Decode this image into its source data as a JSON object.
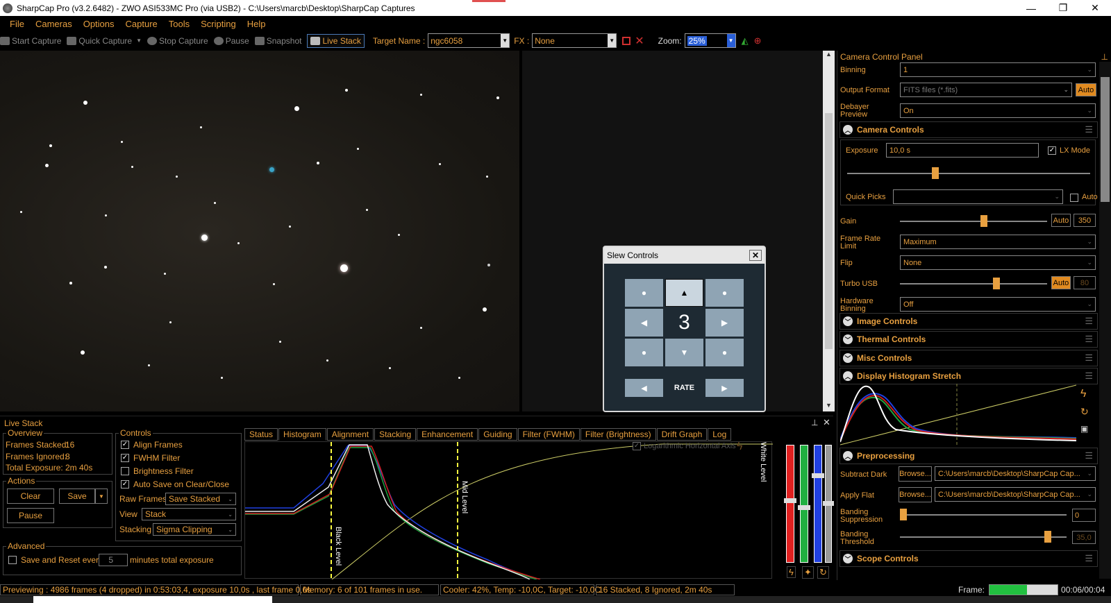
{
  "window": {
    "title": "SharpCap Pro (v3.2.6482) - ZWO ASI533MC Pro (via USB2) - C:\\Users\\marcb\\Desktop\\SharpCap Captures",
    "min": "—",
    "max": "❐",
    "close": "✕"
  },
  "menu": [
    "File",
    "Cameras",
    "Options",
    "Capture",
    "Tools",
    "Scripting",
    "Help"
  ],
  "toolbar": {
    "start_capture": "Start Capture",
    "quick_capture": "Quick Capture",
    "stop_capture": "Stop Capture",
    "pause": "Pause",
    "snapshot": "Snapshot",
    "live_stack": "Live Stack",
    "target_label": "Target Name :",
    "target_value": "ngc6058",
    "fx_label": "FX :",
    "fx_value": "None",
    "zoom_label": "Zoom:",
    "zoom_value": "25%"
  },
  "slew": {
    "title": "Slew Controls",
    "rate_value": "3",
    "rate_label": "RATE"
  },
  "ccp": {
    "title": "Camera Control Panel",
    "binning_label": "Binning",
    "binning_value": "1",
    "output_label": "Output Format",
    "output_value": "FITS files (*.fits)",
    "output_auto": "Auto",
    "debayer_label1": "Debayer",
    "debayer_label2": "Preview",
    "debayer_value": "On",
    "camera_controls": "Camera Controls",
    "exposure_label": "Exposure",
    "exposure_value": "10,0 s",
    "lx_mode": "LX Mode",
    "quick_picks_label": "Quick Picks",
    "quick_picks_auto": "Auto",
    "gain_label": "Gain",
    "gain_auto": "Auto",
    "gain_value": "350",
    "frame_rate_label1": "Frame Rate",
    "frame_rate_label2": "Limit",
    "frame_rate_value": "Maximum",
    "flip_label": "Flip",
    "flip_value": "None",
    "turbo_label": "Turbo USB",
    "turbo_auto": "Auto",
    "turbo_value": "80",
    "hw_binning_label1": "Hardware",
    "hw_binning_label2": "Binning",
    "hw_binning_value": "Off",
    "image_controls": "Image Controls",
    "thermal_controls": "Thermal Controls",
    "misc_controls": "Misc Controls",
    "display_histogram": "Display Histogram Stretch",
    "preprocessing": "Preprocessing",
    "subtract_dark_label": "Subtract Dark",
    "browse": "Browse...",
    "dark_path": "C:\\Users\\marcb\\Desktop\\SharpCap Cap...",
    "apply_flat_label": "Apply Flat",
    "flat_path": "C:\\Users\\marcb\\Desktop\\SharpCap Cap...",
    "banding_supp_label1": "Banding",
    "banding_supp_label2": "Suppression",
    "banding_supp_value": "0",
    "banding_thr_label1": "Banding",
    "banding_thr_label2": "Threshold",
    "banding_thr_value": "35,0",
    "scope_controls": "Scope Controls"
  },
  "live_stack": {
    "title": "Live Stack",
    "overview": "Overview",
    "frames_stacked_label": "Frames Stacked:",
    "frames_stacked": "16",
    "frames_ignored_label": "Frames Ignored:",
    "frames_ignored": "8",
    "total_exposure_label": "Total Exposure:",
    "total_exposure": "2m 40s",
    "actions": "Actions",
    "clear": "Clear",
    "save": "Save",
    "pause": "Pause",
    "controls": "Controls",
    "align_frames": "Align Frames",
    "fwhm_filter": "FWHM Filter",
    "brightness_filter": "Brightness Filter",
    "auto_save": "Auto Save on Clear/Close",
    "raw_frames_label": "Raw Frames",
    "raw_frames_value": "Save Stacked",
    "view_label": "View",
    "view_value": "Stack",
    "stacking_label": "Stacking",
    "stacking_value": "Sigma Clipping",
    "advanced": "Advanced",
    "save_reset_label": "Save and Reset every",
    "save_reset_value": "5",
    "save_reset_suffix": "minutes total exposure",
    "tabs": [
      "Status",
      "Histogram",
      "Alignment",
      "Stacking",
      "Enhancement",
      "Guiding",
      "Filter (FWHM)",
      "Filter (Brightness)",
      "Drift Graph",
      "Log"
    ],
    "log_axis": "Logarithmic Horizontal Axis",
    "black_level": "Black Level",
    "mid_level": "Mid Level",
    "white_level": "White Level"
  },
  "status": {
    "preview": "Previewing : 4986 frames (4 dropped) in 0:53:03,4, exposure 10,0s , last frame 0,0s",
    "memory": "Memory: 6 of 101 frames in use.",
    "cooler": "Cooler: 42%, Temp: -10,0C, Target: -10,0C",
    "stacked": "16 Stacked, 8 Ignored, 2m 40s",
    "frame_label": "Frame:",
    "frame_time": "00:06/00:04",
    "frame_progress": 0.55
  },
  "colors": {
    "accent": "#e8a040",
    "progress": "#22c040"
  }
}
